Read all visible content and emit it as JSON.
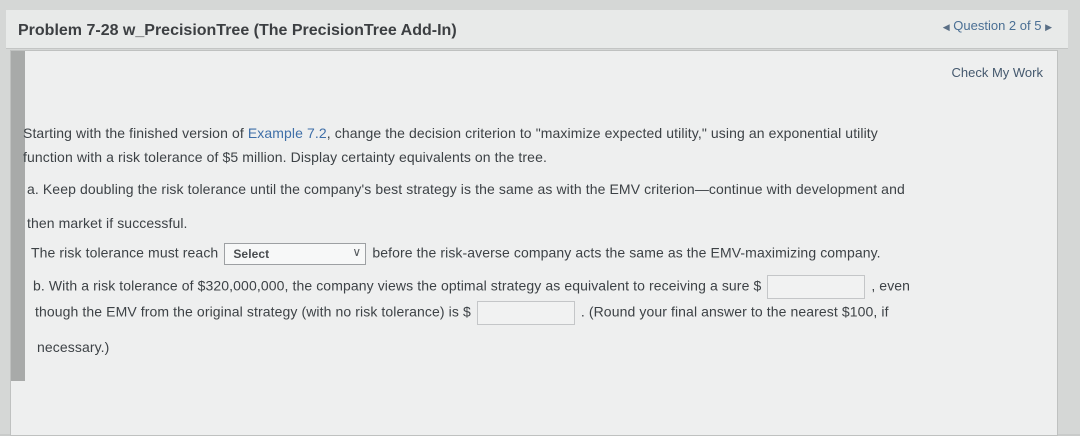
{
  "header": {
    "title": "Problem 7-28 w_PrecisionTree (The PrecisionTree Add-In)",
    "question_nav": "Question 2 of 5"
  },
  "toolbar": {
    "check_label": "Check My Work"
  },
  "content": {
    "intro_line1_pre": "Starting with the finished version of ",
    "intro_link": "Example 7.2",
    "intro_line1_post": ", change the decision criterion to \"maximize expected utility,\" using an exponential utility",
    "intro_line2": "function with a risk tolerance of $5 million. Display certainty equivalents on the tree.",
    "a_line1": "a. Keep doubling the risk tolerance until the company's best strategy is the same as with the EMV criterion—continue with development and",
    "a_line2": "then market if successful.",
    "a_answer_pre": "The risk tolerance must reach",
    "a_select_value": "Select",
    "a_answer_post": "before the risk-averse company acts the same as the EMV-maximizing company.",
    "b_line1": "b. With a risk tolerance of $320,000,000, the company views the optimal strategy as equivalent to receiving a sure $",
    "b_line1_post": ", even",
    "b_line2_pre": "though the EMV from the original strategy (with no risk tolerance) is $",
    "b_line2_post": ". (Round your final answer to the nearest $100, if",
    "b_line3": "necessary.)"
  }
}
